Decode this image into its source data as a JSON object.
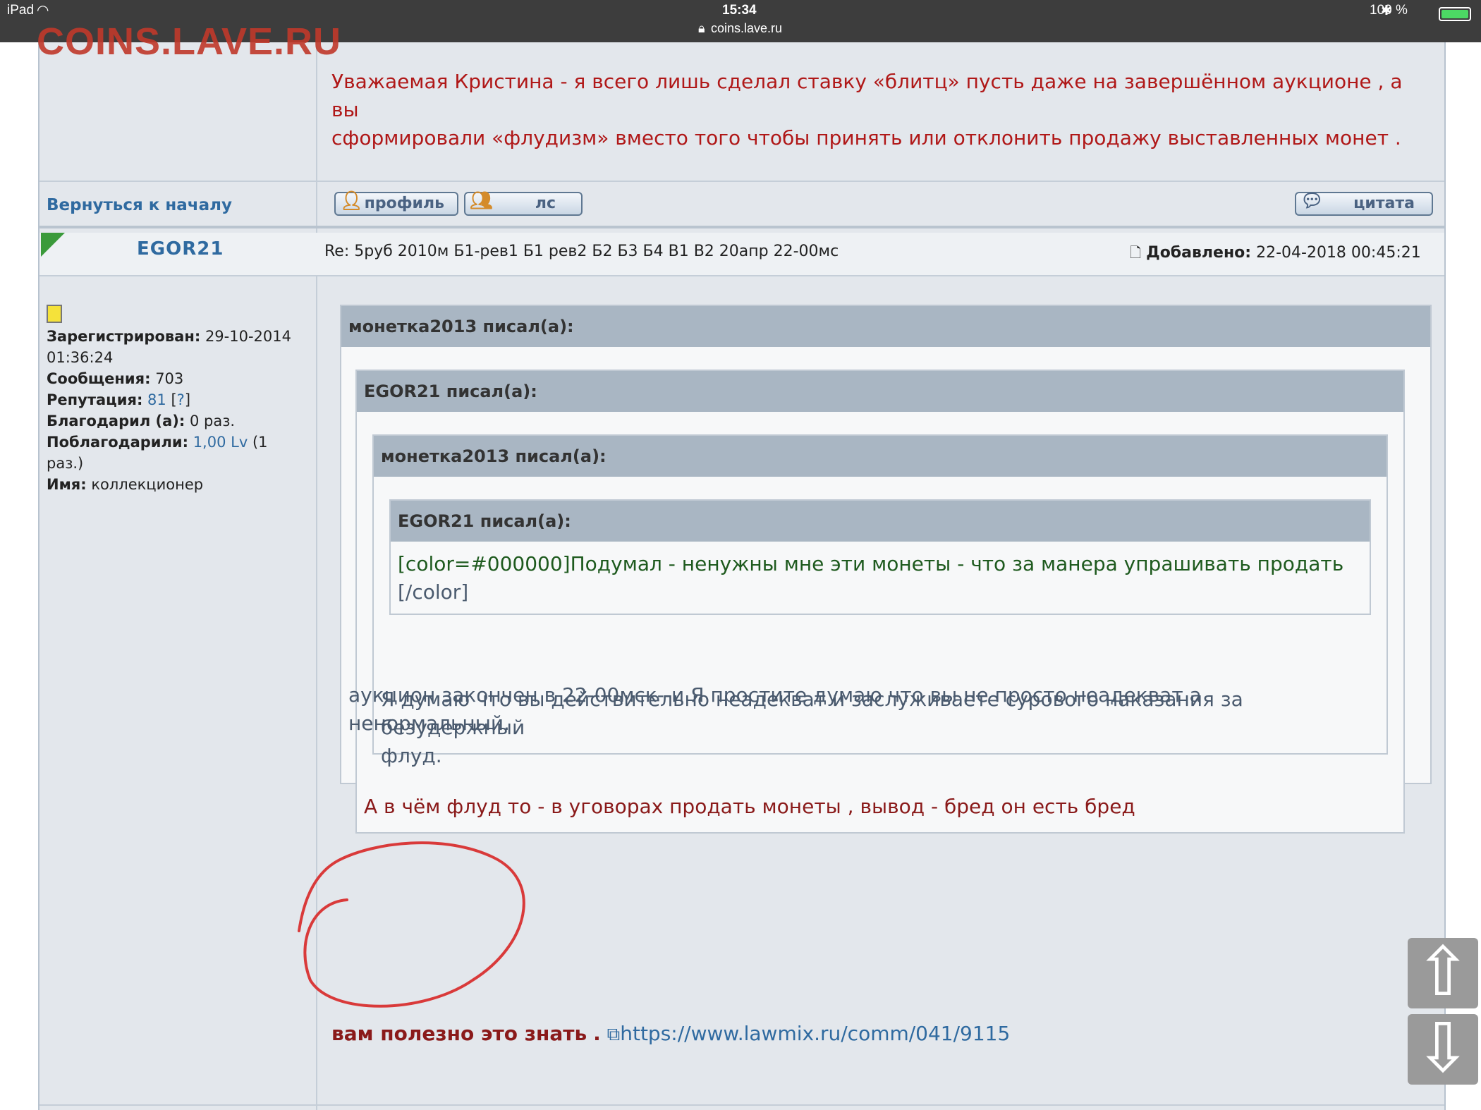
{
  "statusbar": {
    "device": "iPad",
    "time": "15:34",
    "url": "coins.lave.ru",
    "battery": "100 %"
  },
  "watermark": "COINS.LAVE.RU",
  "prev_post": {
    "text_line1": "Уважаемая Кристина - я всего лишь сделал ставку «блитц» пусть даже на завершённом аукционе , а вы",
    "text_line2": "сформировали «флудизм» вместо того чтобы принять или отклонить продажу выставленных монет ."
  },
  "actions": {
    "back_to_top": "Вернуться к началу",
    "profile_label": "профиль",
    "pm_label": "лс",
    "quote_label": "цитата"
  },
  "post": {
    "author": "EGOR21",
    "subject": "Re: 5руб 2010м Б1-рев1 Б1 рев2 Б2 Б3 Б4 В1 В2 20апр 22-00мс",
    "added_label": "Добавлено:",
    "added_value": "22-04-2018 00:45:21"
  },
  "profile": {
    "registered_label": "Зарегистрирован:",
    "registered_date": "29-10-2014",
    "registered_time": "01:36:24",
    "messages_label": "Сообщения:",
    "messages_value": "703",
    "reputation_label": "Репутация:",
    "reputation_value": "81",
    "reputation_help_open": "[",
    "reputation_help": "?",
    "reputation_help_close": "]",
    "thanked_label": "Благодарил (а):",
    "thanked_value": "0 раз.",
    "got_thanks_label": "Поблагодарили:",
    "got_thanks_value": "1,00 Lv",
    "got_thanks_count_1": "(1",
    "got_thanks_count_2": "раз.)",
    "name_label": "Имя:",
    "name_value": "коллекционер"
  },
  "quotes": {
    "q1_header": "монетка2013 писал(а):",
    "q2_header": "EGOR21 писал(а):",
    "q3_header": "монетка2013 писал(а):",
    "q4_header": "EGOR21 писал(а):",
    "q4_text_line1": "[color=#000000]Подумал - ненужны мне эти монеты - что за манера упрашивать продать",
    "q4_text_line2": "[/color]",
    "q3_text_line1": "Я думаю что вы действительно неадекват и заслуживаете сурового наказания за безудержный",
    "q3_text_line2": "флуд.",
    "q2_text": "А в чём флуд то - в уговорах продать монеты , вывод - бред он есть бред",
    "q1_text_line1": "аукцион закончен в 22-00мск--и Я простите думаю что вы не просто неадекват а",
    "q1_text_line2": "ненормальный."
  },
  "footer_text": {
    "prefix": "вам полезно это знать",
    "dot": ".",
    "link": "https://www.lawmix.ru/comm/041/9115"
  },
  "colors": {
    "accent_red": "#b01818",
    "link_blue": "#2f6aa0",
    "annotation_circle": "#d93a3a"
  }
}
